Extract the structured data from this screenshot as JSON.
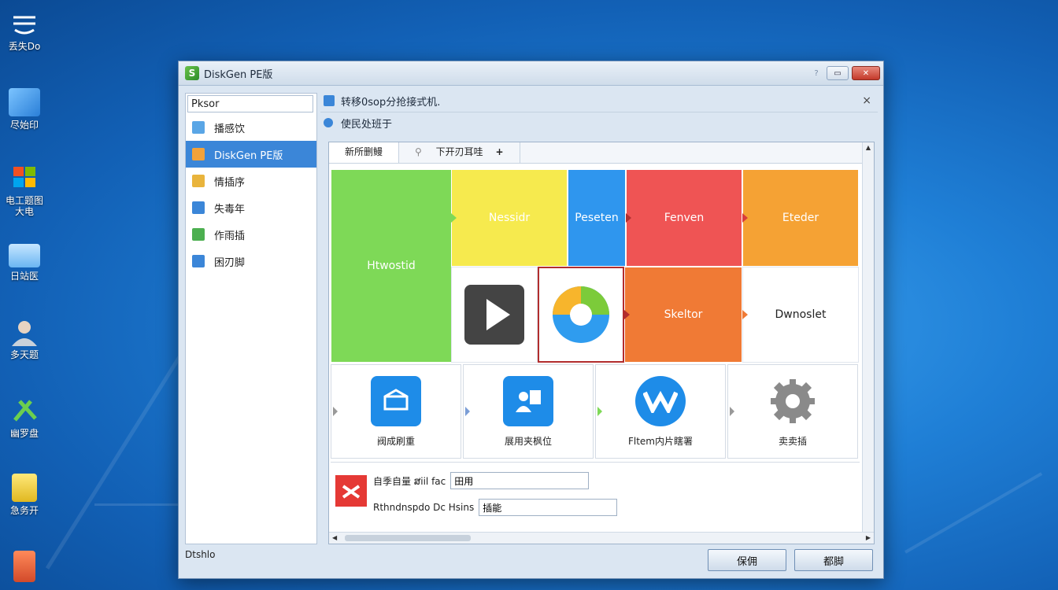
{
  "desktop": {
    "icons": [
      {
        "label": "丢失Do",
        "icon": "network-icon",
        "color": "#e8f2ff"
      },
      {
        "label": "尽始印",
        "icon": "computer-icon",
        "color": "#4aa0f0"
      },
      {
        "label": "电工题图",
        "label2": "大电",
        "icon": "windows-logo-icon",
        "color": "#f0b52c"
      },
      {
        "label": "日站医",
        "icon": "monitor-icon",
        "color": "#9fd1f7"
      },
      {
        "label": "多天题",
        "icon": "user-icon",
        "color": "#cfd6de"
      },
      {
        "label": "幽罗盘",
        "icon": "tools-icon",
        "color": "#5bbf4a"
      },
      {
        "label": "急务开",
        "icon": "toolbox-icon",
        "color": "#f0d03c"
      },
      {
        "label": "",
        "icon": "app-icon",
        "color": "#e25a3a"
      }
    ]
  },
  "window": {
    "title": "DiskGen PE版",
    "help_glyph": "?",
    "minimize_glyph": "▭",
    "close_glyph": "✕"
  },
  "sidebar": {
    "search_value": "Pksor",
    "items": [
      {
        "label": "播感饮",
        "icon": "image-icon",
        "color": "#5aa6e6"
      },
      {
        "label": "DiskGen  PE版",
        "icon": "disk-icon",
        "color": "#f2a23a",
        "active": true
      },
      {
        "label": "情插序",
        "icon": "windows-flag-icon",
        "color": "#e9b43c"
      },
      {
        "label": "失毒年",
        "icon": "chart-icon",
        "color": "#3b86d8"
      },
      {
        "label": "作雨插",
        "icon": "grid-icon",
        "color": "#4caf50"
      },
      {
        "label": "困刃脚",
        "icon": "monitor-icon",
        "color": "#3b86d8"
      }
    ]
  },
  "main": {
    "header": "转移0sop分抢接式机.",
    "subheader": "使民处班于",
    "close_glyph": "×",
    "tabs": [
      {
        "label": "新所删鳗",
        "active": true
      },
      {
        "label": "下开刃耳哇",
        "pin": "⚲",
        "plus": "+"
      }
    ],
    "tiles": [
      {
        "label": "Htwostid",
        "color": "#7ed957"
      },
      {
        "label": "Nessidr",
        "color": "#f6ea4e"
      },
      {
        "label": "Peseten",
        "color": "#2f96ee"
      },
      {
        "label": "Fenven",
        "color": "#ef5454"
      },
      {
        "label": "Eteder",
        "color": "#f5a234"
      },
      {
        "label": "Skeltor",
        "color": "#f07a35"
      },
      {
        "label": "Dwnoslet",
        "color": "#ffffff"
      }
    ],
    "tools": [
      {
        "label": "阀成刷重",
        "icon": "box-icon",
        "color": "#1e8ce8"
      },
      {
        "label": "展用夹枫位",
        "icon": "user-card-icon",
        "color": "#1e8ce8"
      },
      {
        "label": "Fltem内片瞎署",
        "icon": "w-logo-icon",
        "color": "#1e8ce8"
      },
      {
        "label": "卖卖插",
        "icon": "gear-icon",
        "color": "#8a8a8a"
      }
    ],
    "form": {
      "row1_label": "自季自量 ສiil fac",
      "row1_value": "田用",
      "row2_label": "Rthndnspdo Dc Hsins",
      "row2_value": "插能"
    }
  },
  "footer": {
    "status": "Dtshlo",
    "ok_label": "保佣",
    "cancel_label": "都脚"
  },
  "colors": {
    "accent": "#3b86d8",
    "desktop_bg": "#1f7fd6"
  }
}
